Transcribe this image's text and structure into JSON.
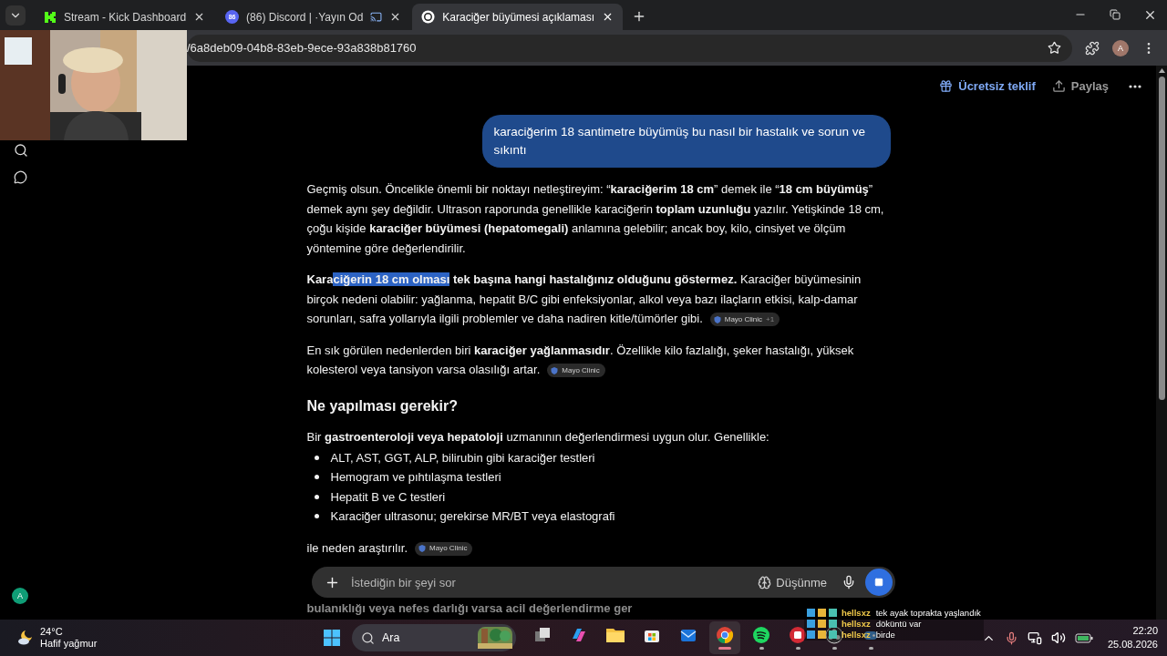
{
  "browser": {
    "tabs": [
      {
        "title": "Stream - Kick Dashboard",
        "kind": "kick",
        "selected": false
      },
      {
        "title": "(86) Discord | ·Yayın Od",
        "kind": "discord",
        "badge": "86",
        "selected": false
      },
      {
        "title": "Karaciğer büyümesi açıklaması",
        "kind": "chat",
        "selected": true
      }
    ],
    "url": "/6a8deb09-04b8-83eb-9ece-93a838b81760",
    "profile": "A"
  },
  "header": {
    "offer": "Ücretsiz teklif",
    "share": "Paylaş"
  },
  "sidebar": {
    "avatar": "A"
  },
  "user_message": "karaciğerim 18 santimetre büyümüş bu nasıl bir hastalık ve sorun ve sıkıntı",
  "response": [
    {
      "kind": "paragraph",
      "parts": [
        {
          "text": "Geçmiş olsun. Öncelikle önemli bir noktayı netleştireyim: “**karaciğerim 18 cm**” demek ile “**18 cm büyümüş**” demek aynı şey değildir. Ultrason raporunda genellikle karaciğerin **toplam uzunluğu** yazılır. Yetişkinde 18 cm, çoğu kişide **karaciğer büyümesi (hepatomegali)** anlamına gelebilir; ancak boy, kilo, cinsiyet ve ölçüm yöntemine göre değerlendirilir.",
          "highlighted": false
        }
      ]
    },
    {
      "kind": "paragraph",
      "parts": [
        {
          "text": "**Kara**",
          "highlighted": false
        },
        {
          "text": "**ciğerin 18 cm olması**",
          "highlighted": true
        },
        {
          "text": " **tek başına hangi hastalığınız olduğunu göstermez.** Karaciğer büyümesinin birçok nedeni olabilir: yağlanma, hepatit B/C gibi enfeksiyonlar, alkol veya bazı ilaçların etkisi, kalp-damar sorunları, safra yollarıyla ilgili problemler ve daha nadiren kitle/tümörler gibi.",
          "highlighted": false
        }
      ],
      "citation": {
        "label": "Mayo Clinic",
        "extra": "+1"
      }
    },
    {
      "kind": "paragraph",
      "parts": [
        {
          "text": "En sık görülen nedenlerden biri **karaciğer yağlanmasıdır**. Özellikle kilo fazlalığı, şeker hastalığı, yüksek kolesterol veya tansiyon varsa olasılığı artar.",
          "highlighted": false
        }
      ],
      "citation": {
        "label": "Mayo Clinic"
      }
    },
    {
      "kind": "heading",
      "text": "Ne yapılması gerekir?"
    },
    {
      "kind": "paragraph",
      "parts": [
        {
          "text": "Bir **gastroenteroloji veya hepatoloji** uzmanının değerlendirmesi uygun olur. Genellikle:",
          "highlighted": false
        }
      ]
    },
    {
      "kind": "list",
      "items": [
        "ALT, AST, GGT, ALP, bilirubin gibi karaciğer testleri",
        "Hemogram ve pıhtılaşma testleri",
        "Hepatit B ve C testleri",
        "Karaciğer ultrasonu; gerekirse MR/BT veya elastografi"
      ]
    },
    {
      "kind": "paragraph",
      "parts": [
        {
          "text": "ile neden araştırılır.",
          "highlighted": false
        }
      ],
      "citation": {
        "label": "Mayo Clinic"
      }
    }
  ],
  "partial_line": "bulanıklığı veya nefes darlığı varsa acil değerlendirme ger",
  "composer": {
    "placeholder": "İstediğin bir şeyi sor",
    "mode": "Düşünme"
  },
  "taskbar": {
    "temperature": "24°C",
    "weather": "Hafif yağmur",
    "search": "Ara",
    "apps": [
      {
        "kind": "taskview",
        "running": false,
        "active": false
      },
      {
        "kind": "copilot",
        "running": false,
        "active": false
      },
      {
        "kind": "folder",
        "running": false,
        "active": false
      },
      {
        "kind": "store",
        "running": false,
        "active": false
      },
      {
        "kind": "mail",
        "running": false,
        "active": false
      },
      {
        "kind": "chrome",
        "running": true,
        "active": true
      },
      {
        "kind": "spotify",
        "running": true,
        "active": false
      },
      {
        "kind": "fist",
        "running": true,
        "active": false
      },
      {
        "kind": "obs",
        "running": true,
        "active": false
      },
      {
        "kind": "game",
        "running": true,
        "active": false
      }
    ],
    "time": "22:20",
    "date": "25.08.2026"
  },
  "chat_overlay": [
    {
      "user": "hellsxz",
      "message": "tek ayak toprakta yaşlandık"
    },
    {
      "user": "hellsxz",
      "message": "döküntü var"
    },
    {
      "user": "hellsxz",
      "message": "birde"
    }
  ]
}
